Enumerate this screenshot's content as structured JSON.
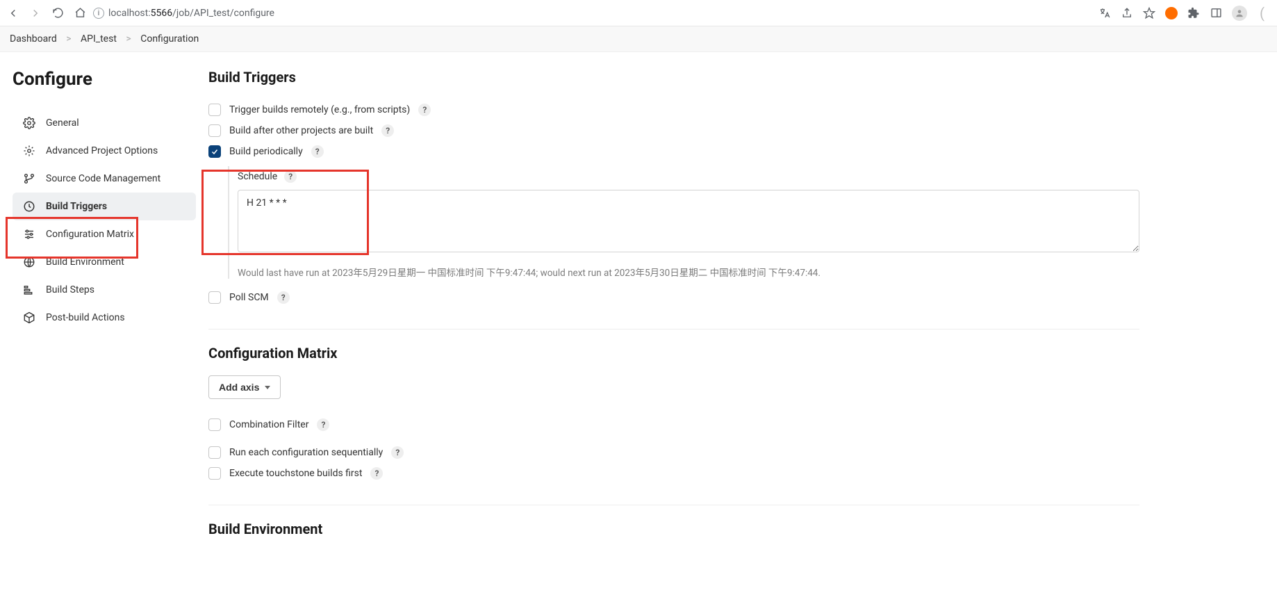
{
  "browser": {
    "url_prefix": "localhost:",
    "url_port": "5566",
    "url_path": "/job/API_test/configure"
  },
  "breadcrumbs": {
    "items": [
      "Dashboard",
      "API_test",
      "Configuration"
    ]
  },
  "page_title": "Configure",
  "sidebar": {
    "items": [
      {
        "label": "General",
        "icon": "gear"
      },
      {
        "label": "Advanced Project Options",
        "icon": "gear"
      },
      {
        "label": "Source Code Management",
        "icon": "branch"
      },
      {
        "label": "Build Triggers",
        "icon": "clock",
        "active": true
      },
      {
        "label": "Configuration Matrix",
        "icon": "sliders"
      },
      {
        "label": "Build Environment",
        "icon": "globe"
      },
      {
        "label": "Build Steps",
        "icon": "steps"
      },
      {
        "label": "Post-build Actions",
        "icon": "box"
      }
    ]
  },
  "sections": {
    "build_triggers": {
      "title": "Build Triggers",
      "options": {
        "remote": "Trigger builds remotely (e.g., from scripts)",
        "after": "Build after other projects are built",
        "periodic": "Build periodically",
        "poll": "Poll SCM"
      },
      "schedule_label": "Schedule",
      "schedule_value": "H 21 * * *",
      "schedule_info": "Would last have run at 2023年5月29日星期一 中国标准时间 下午9:47:44; would next run at 2023年5月30日星期二 中国标准时间 下午9:47:44."
    },
    "config_matrix": {
      "title": "Configuration Matrix",
      "add_axis": "Add axis",
      "options": {
        "combination": "Combination Filter",
        "sequential": "Run each configuration sequentially",
        "touchstone": "Execute touchstone builds first"
      }
    },
    "build_env": {
      "title": "Build Environment"
    }
  }
}
